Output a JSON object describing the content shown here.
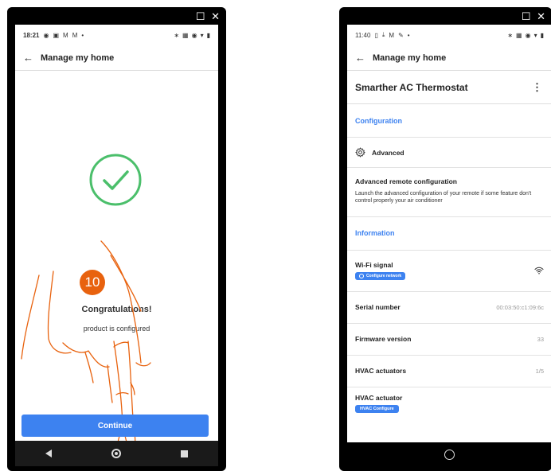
{
  "left": {
    "status": {
      "time": "18:21"
    },
    "appbar": {
      "back_icon": "←",
      "title": "Manage my home"
    },
    "step_badge": "10",
    "message_title": "Congratulations!",
    "message_body": "product is configured",
    "continue_label": "Continue",
    "colors": {
      "accent": "#3d82f0",
      "success": "#4bbf6b",
      "badge": "#e8620e"
    }
  },
  "right": {
    "status": {
      "time": "11:40"
    },
    "appbar": {
      "back_icon": "←",
      "title": "Manage my home"
    },
    "device_title": "Smarther AC Thermostat",
    "menu_icon": "⋮",
    "configuration_header": "Configuration",
    "advanced_label": "Advanced",
    "remote": {
      "title": "Advanced remote configuration",
      "description": "Launch the advanced configuration of your remote if some feature don't control properly your air conditioner"
    },
    "information_header": "Information",
    "wifi": {
      "label": "Wi-Fi signal",
      "chip": "Configure network"
    },
    "rows": [
      {
        "label": "Serial number",
        "value": "00:03:50:c1:09:6c"
      },
      {
        "label": "Firmware version",
        "value": "33"
      },
      {
        "label": "HVAC actuators",
        "value": "1/5"
      }
    ],
    "actuator": {
      "label": "HVAC actuator",
      "chip": "HVAC Configure"
    }
  },
  "window_icons": "☐ ✕"
}
